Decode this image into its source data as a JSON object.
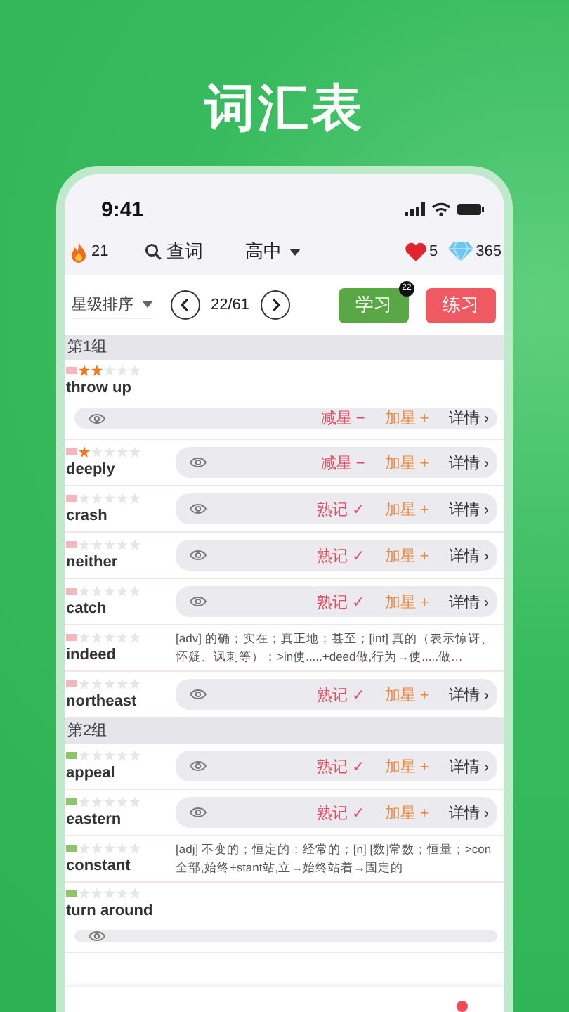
{
  "heading": "词汇表",
  "status_bar": {
    "time": "9:41"
  },
  "top_bar": {
    "streak": "21",
    "search_label": "查词",
    "level_label": "高中",
    "hearts": "5",
    "gems": "365"
  },
  "controls": {
    "sort_label": "星级排序",
    "page": "22/61",
    "study": {
      "label": "学习",
      "badge": "22"
    },
    "practice": {
      "label": "练习"
    }
  },
  "groups": [
    {
      "title": "第1组",
      "color": "#f4b7bd",
      "words": [
        {
          "word": "throw up",
          "stars": 2,
          "kind": "below",
          "actions": [
            "减星 −",
            "加星 +",
            "详情 ›"
          ]
        },
        {
          "word": "deeply",
          "stars": 1,
          "kind": "inline",
          "actions": [
            "减星 −",
            "加星 +",
            "详情 ›"
          ]
        },
        {
          "word": "crash",
          "stars": 0,
          "kind": "inline",
          "actions": [
            "熟记 ✓",
            "加星 +",
            "详情 ›"
          ]
        },
        {
          "word": "neither",
          "stars": 0,
          "kind": "inline",
          "actions": [
            "熟记 ✓",
            "加星 +",
            "详情 ›"
          ]
        },
        {
          "word": "catch",
          "stars": 0,
          "kind": "inline",
          "actions": [
            "熟记 ✓",
            "加星 +",
            "详情 ›"
          ]
        },
        {
          "word": "indeed",
          "stars": 0,
          "kind": "meaning",
          "meaning": "[adv] 的确；实在；真正地；甚至；[int] 真的（表示惊讶、怀疑、讽刺等）；>in使.....+deed做,行为→使.....做…"
        },
        {
          "word": "northeast",
          "stars": 0,
          "kind": "inline",
          "actions": [
            "熟记 ✓",
            "加星 +",
            "详情 ›"
          ]
        }
      ]
    },
    {
      "title": "第2组",
      "color": "#8dc46c",
      "words": [
        {
          "word": "appeal",
          "stars": 0,
          "kind": "inline",
          "actions": [
            "熟记 ✓",
            "加星 +",
            "详情 ›"
          ]
        },
        {
          "word": "eastern",
          "stars": 0,
          "kind": "inline",
          "actions": [
            "熟记 ✓",
            "加星 +",
            "详情 ›"
          ]
        },
        {
          "word": "constant",
          "stars": 0,
          "kind": "meaning",
          "meaning": "[adj] 不变的；恒定的；经常的；[n] [数]常数；恒量；>con全部,始终+stant站,立→始终站着→固定的"
        },
        {
          "word": "turn around",
          "stars": 0,
          "kind": "below"
        }
      ]
    }
  ]
}
